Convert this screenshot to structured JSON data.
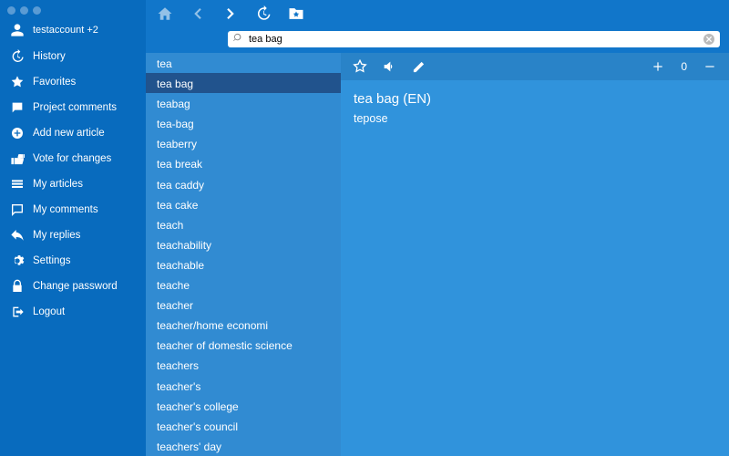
{
  "user": {
    "label": "testaccount  +2"
  },
  "menu": [
    {
      "label": "History"
    },
    {
      "label": "Favorites"
    },
    {
      "label": "Project comments"
    },
    {
      "label": "Add new article"
    },
    {
      "label": "Vote for changes"
    },
    {
      "label": "My articles"
    },
    {
      "label": "My comments"
    },
    {
      "label": "My replies"
    },
    {
      "label": "Settings"
    },
    {
      "label": "Change password"
    },
    {
      "label": "Logout"
    }
  ],
  "search": {
    "value": "tea bag"
  },
  "wordlist": [
    "tea",
    "tea bag",
    "teabag",
    "tea-bag",
    "teaberry",
    "tea break",
    "tea caddy",
    "tea cake",
    "teach",
    "teachability",
    "teachable",
    "teache",
    "teacher",
    "teacher/home economi",
    "teacher of domestic science",
    "teachers",
    "teacher's",
    "teacher's college",
    "teacher's council",
    "teachers' day"
  ],
  "wordlist_selected": 1,
  "detail": {
    "headword": "tea bag (EN)",
    "translation": "tepose",
    "count": "0"
  }
}
